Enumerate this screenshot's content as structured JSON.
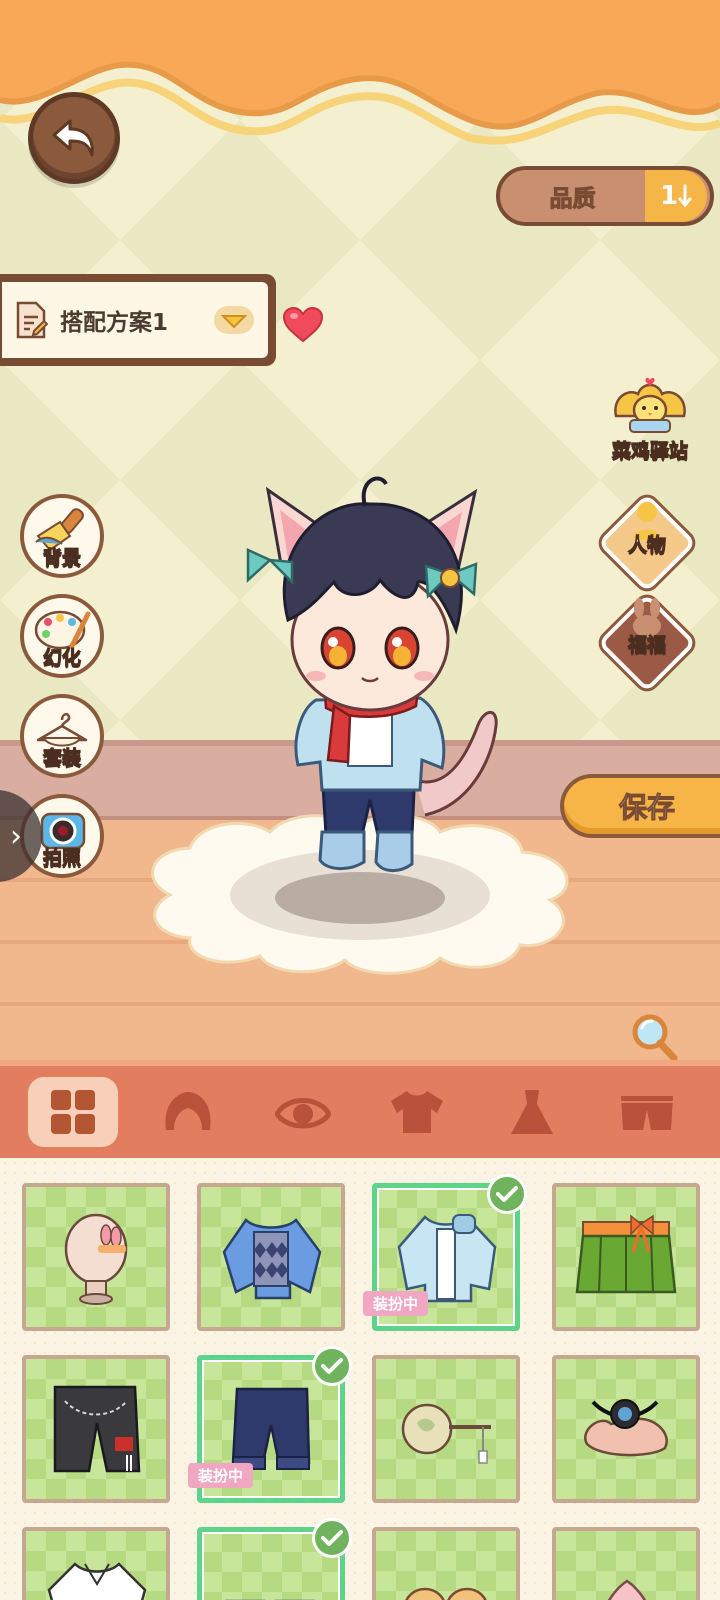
{
  "header": {
    "back_icon": "back-arrow-icon",
    "quality_label": "品质",
    "quality_value": "1"
  },
  "outfit_plan": {
    "name": "搭配方案1"
  },
  "left_menu": [
    {
      "label": "背景",
      "icon": "broom-icon"
    },
    {
      "label": "幻化",
      "icon": "palette-icon"
    },
    {
      "label": "套装",
      "icon": "hanger-icon"
    },
    {
      "label": "拍照",
      "icon": "camera-icon"
    }
  ],
  "right_menu": {
    "station_label": "菜鸡驿站",
    "character_label": "人物",
    "pet_label": "福福",
    "save_label": "保存"
  },
  "categories": [
    {
      "name": "all",
      "icon": "grid-icon",
      "active": true
    },
    {
      "name": "hair",
      "icon": "hair-icon",
      "active": false
    },
    {
      "name": "eyes",
      "icon": "eye-icon",
      "active": false
    },
    {
      "name": "top",
      "icon": "shirt-icon",
      "active": false
    },
    {
      "name": "dress",
      "icon": "dress-icon",
      "active": false
    },
    {
      "name": "bottom",
      "icon": "shorts-icon",
      "active": false
    }
  ],
  "items": {
    "wearing_badge": "装扮中",
    "list": [
      {
        "name": "head-accessory",
        "equipped": false
      },
      {
        "name": "argyle-sweater",
        "equipped": false
      },
      {
        "name": "light-blue-jacket",
        "equipped": true
      },
      {
        "name": "green-skirt",
        "equipped": false
      },
      {
        "name": "black-shorts",
        "equipped": false
      },
      {
        "name": "navy-shorts",
        "equipped": true
      },
      {
        "name": "flower-fan",
        "equipped": false
      },
      {
        "name": "goggles",
        "equipped": false
      },
      {
        "name": "white-shirt",
        "equipped": false
      },
      {
        "name": "blue-shoes",
        "equipped": true
      },
      {
        "name": "paws",
        "equipped": false
      },
      {
        "name": "pink-item",
        "equipped": false
      }
    ]
  },
  "colors": {
    "accent_orange": "#f5b547",
    "brown_border": "#7a4b33",
    "category_bar": "#e27d5f",
    "selected_green": "#5dd48a"
  }
}
